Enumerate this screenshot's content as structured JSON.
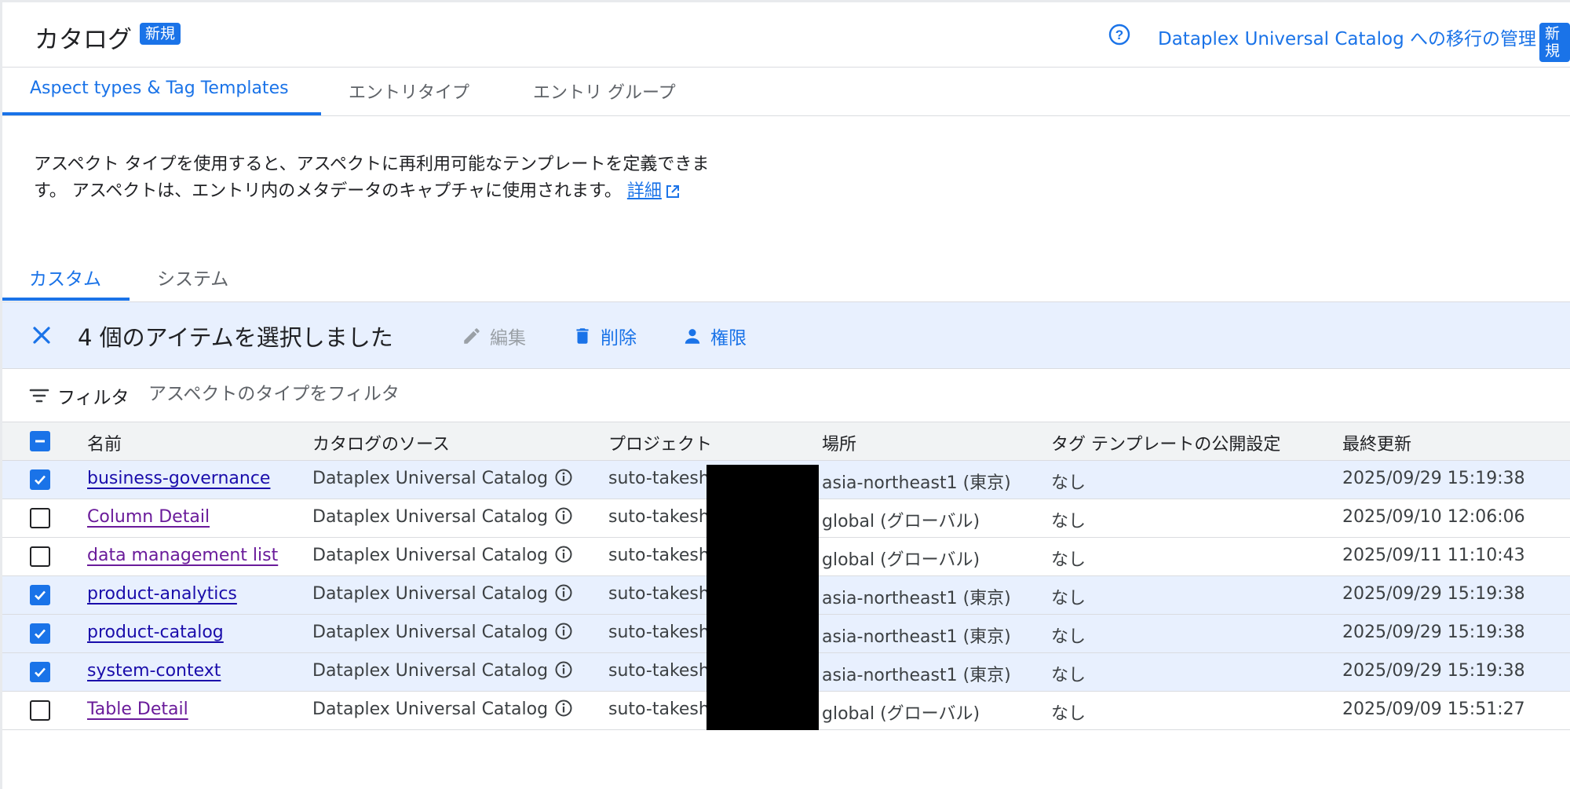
{
  "header": {
    "title": "カタログ",
    "title_badge": "新規",
    "migration_link": "Dataplex Universal Catalog への移行の管理",
    "migration_badge": "新規"
  },
  "tabs": [
    {
      "label": "Aspect types & Tag Templates",
      "active": true
    },
    {
      "label": "エントリタイプ",
      "active": false
    },
    {
      "label": "エントリ グループ",
      "active": false
    }
  ],
  "description": {
    "text": "アスペクト タイプを使用すると、アスペクトに再利用可能なテンプレートを定義できます。 アスペクトは、エントリ内のメタデータのキャプチャに使用されます。",
    "link": "詳細"
  },
  "subtabs": [
    {
      "label": "カスタム",
      "active": true
    },
    {
      "label": "システム",
      "active": false
    }
  ],
  "selection_bar": {
    "text": "4 個のアイテムを選択しました",
    "edit_label": "編集",
    "delete_label": "削除",
    "permissions_label": "権限"
  },
  "filter": {
    "label": "フィルタ",
    "placeholder": "アスペクトのタイプをフィルタ"
  },
  "table": {
    "columns": [
      "名前",
      "カタログのソース",
      "プロジェクト",
      "場所",
      "タグ テンプレートの公開設定",
      "最終更新"
    ],
    "rows": [
      {
        "checked": true,
        "name": "business-governance",
        "source": "Dataplex Universal Catalog",
        "project": "suto-takesh",
        "location": "asia-northeast1 (東京)",
        "visibility": "なし",
        "updated": "2025/09/29 15:19:38"
      },
      {
        "checked": false,
        "name": "Column Detail",
        "source": "Dataplex Universal Catalog",
        "project": "suto-takesh",
        "location": "global (グローバル)",
        "visibility": "なし",
        "updated": "2025/09/10 12:06:06"
      },
      {
        "checked": false,
        "name": "data management list",
        "source": "Dataplex Universal Catalog",
        "project": "suto-takesh",
        "location": "global (グローバル)",
        "visibility": "なし",
        "updated": "2025/09/11 11:10:43"
      },
      {
        "checked": true,
        "name": "product-analytics",
        "source": "Dataplex Universal Catalog",
        "project": "suto-takesh",
        "location": "asia-northeast1 (東京)",
        "visibility": "なし",
        "updated": "2025/09/29 15:19:38"
      },
      {
        "checked": true,
        "name": "product-catalog",
        "source": "Dataplex Universal Catalog",
        "project": "suto-takesh",
        "location": "asia-northeast1 (東京)",
        "visibility": "なし",
        "updated": "2025/09/29 15:19:38"
      },
      {
        "checked": true,
        "name": "system-context",
        "source": "Dataplex Universal Catalog",
        "project": "suto-takesh",
        "location": "asia-northeast1 (東京)",
        "visibility": "なし",
        "updated": "2025/09/29 15:19:38"
      },
      {
        "checked": false,
        "name": "Table Detail",
        "source": "Dataplex Universal Catalog",
        "project": "suto-takesh",
        "location": "global (グローバル)",
        "visibility": "なし",
        "updated": "2025/09/09 15:51:27"
      }
    ]
  },
  "colors": {
    "accent": "#1a73e8",
    "selection_bg": "#e8f0fe",
    "visited_link": "#6a1b9a",
    "header_bg": "#f1f3f4"
  },
  "icons": {
    "help": "help-circle-icon",
    "external_link": "external-link-icon",
    "close": "close-icon",
    "edit": "pencil-icon",
    "delete": "trash-icon",
    "permissions": "person-icon",
    "filter": "filter-lines-icon",
    "info": "info-circle-icon"
  }
}
